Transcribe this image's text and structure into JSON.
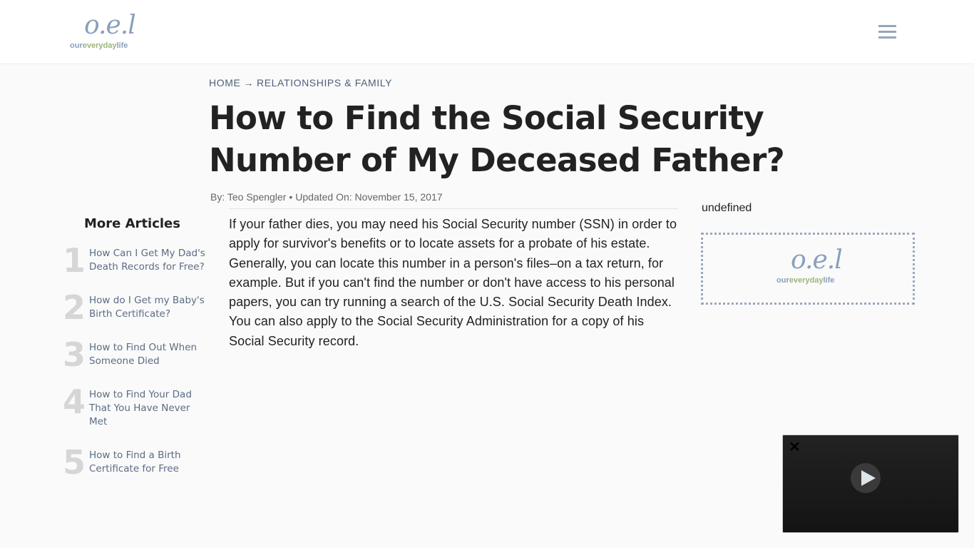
{
  "header": {
    "logo": {
      "mark": "o.e.l",
      "word_part1": "our",
      "word_part2": "everyday",
      "word_part3": "life"
    },
    "menu_icon": "hamburger-menu-icon"
  },
  "breadcrumb": {
    "home": "HOME",
    "separator": "→",
    "category": "RELATIONSHIPS & FAMILY"
  },
  "article": {
    "title": "How to Find the Social Security Number of My Deceased Father?",
    "byline": {
      "author": "By: Teo Spengler",
      "separator": "•",
      "updated": "Updated On: November 15, 2017"
    },
    "body": "If your father dies, you may need his Social Security number (SSN) in order to apply for survivor's benefits or to locate assets for a probate of his estate. Generally, you can locate this number in a person's files–on a tax return, for example. But if you can't find the number or don't have access to his personal papers, you can try running a search of the U.S. Social Security Death Index. You can also apply to the Social Security Administration for a copy of his Social Security record."
  },
  "sidebar": {
    "heading": "More Articles",
    "items": [
      {
        "num": "1",
        "label": "How Can I Get My Dad's Death Records for Free?"
      },
      {
        "num": "2",
        "label": "How do I Get my Baby's Birth Certificate?"
      },
      {
        "num": "3",
        "label": "How to Find Out When Someone Died"
      },
      {
        "num": "4",
        "label": "How to Find Your Dad That You Have Never Met"
      },
      {
        "num": "5",
        "label": "How to Find a Birth Certificate for Free"
      }
    ]
  },
  "right_rail": {
    "label": "undefined",
    "ad_logo": {
      "mark": "o.e.l",
      "word_part1": "our",
      "word_part2": "everyday",
      "word_part3": "life"
    }
  },
  "video": {
    "close_glyph": "✕"
  }
}
